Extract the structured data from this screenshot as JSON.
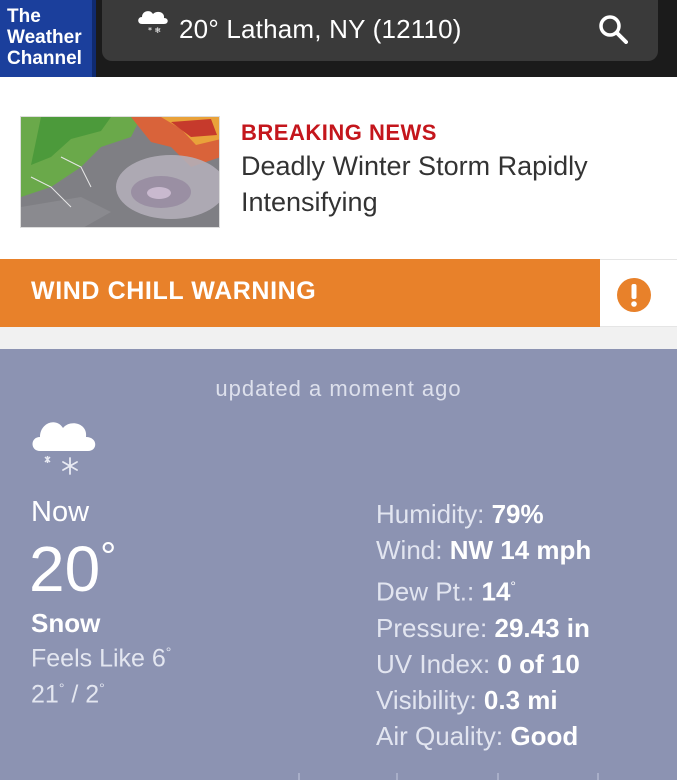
{
  "header": {
    "logo_lines": [
      "The",
      "Weather",
      "Channel"
    ],
    "location": "20° Latham, NY (12110)",
    "search_icon": "search-icon",
    "weather_icon": "snow-cloud-icon"
  },
  "news": {
    "label": "BREAKING NEWS",
    "title": "Deadly Winter Storm Rapidly Intensifying",
    "image": "storm-radar-thumbnail"
  },
  "alert": {
    "label": "WIND CHILL WARNING",
    "icon": "exclamation-icon",
    "color": "#e8812a"
  },
  "current": {
    "updated": "updated a moment ago",
    "now_label": "Now",
    "temperature": "20",
    "condition": "Snow",
    "feels_like": "Feels Like 6",
    "hi_lo_high": "21",
    "hi_lo_low": "2",
    "details": [
      {
        "label": "Humidity:",
        "value": "79%"
      },
      {
        "label": "Wind:",
        "value": "NW 14 mph"
      },
      {
        "label": "Dew Pt.:",
        "value": "14"
      },
      {
        "label": "Pressure:",
        "value": "29.43 in"
      },
      {
        "label": "UV Index:",
        "value": "0 of 10"
      },
      {
        "label": "Visibility:",
        "value": "0.3 mi"
      },
      {
        "label": "Air Quality:",
        "value": "Good"
      }
    ]
  },
  "colors": {
    "header_bg": "#1b1b1b",
    "logo_bg": "#1b3f9c",
    "breaking": "#c4161c",
    "panel_bg": "#8c93b2"
  }
}
